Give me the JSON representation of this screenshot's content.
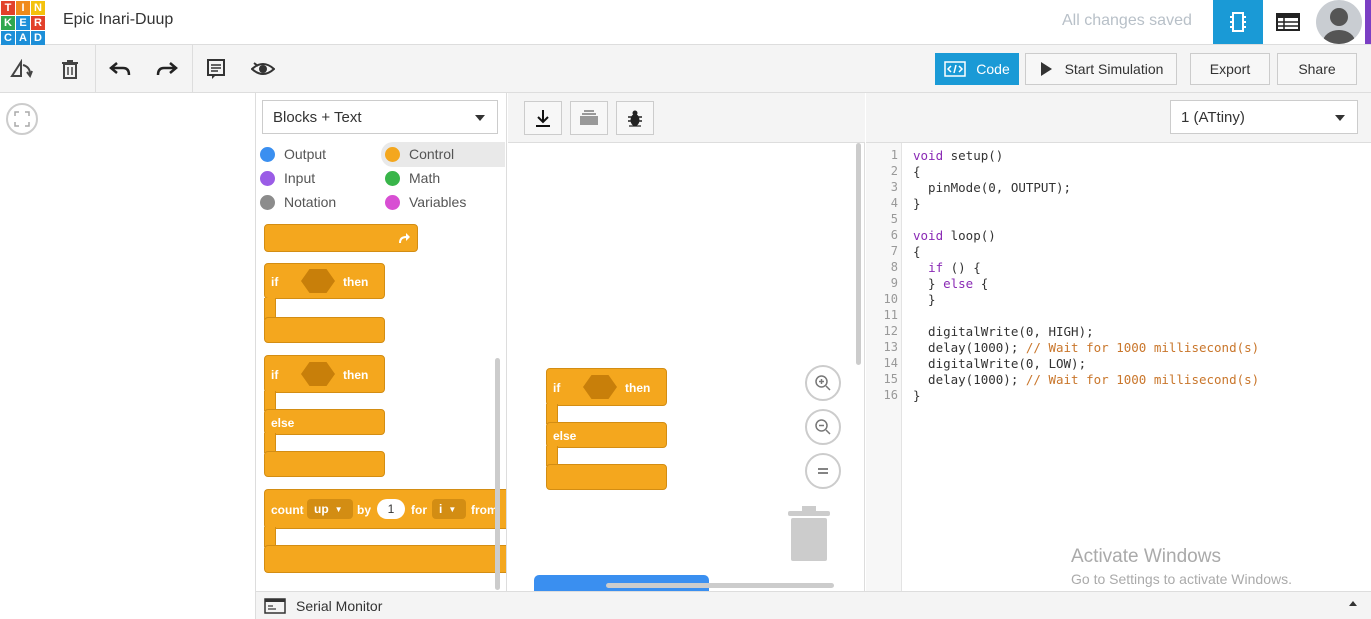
{
  "logo": {
    "letters": [
      "T",
      "I",
      "N",
      "K",
      "E",
      "R",
      "C",
      "A",
      "D"
    ],
    "colors": [
      "#e2412b",
      "#f08a1c",
      "#f4c20d",
      "#2fa84f",
      "#1d8fd8",
      "#e2412b",
      "#1d8fd8",
      "#1d8fd8",
      "#1d8fd8"
    ]
  },
  "header": {
    "project_title": "Epic Inari-Duup",
    "status": "All changes saved"
  },
  "toolbar": {
    "code_label": "Code",
    "simulation_label": "Start Simulation",
    "export_label": "Export",
    "share_label": "Share"
  },
  "blocks_panel": {
    "mode_select": "Blocks + Text",
    "categories": [
      {
        "label": "Output",
        "color": "#3a8ff0"
      },
      {
        "label": "Control",
        "color": "#f4a71e"
      },
      {
        "label": "Input",
        "color": "#9a5ce6"
      },
      {
        "label": "Math",
        "color": "#39b54a"
      },
      {
        "label": "Notation",
        "color": "#8c8c8c"
      },
      {
        "label": "Variables",
        "color": "#d84fd3"
      }
    ],
    "block_words": {
      "if": "if",
      "then": "then",
      "else": "else",
      "count": "count",
      "up": "up",
      "by": "by",
      "one": "1",
      "for": "for",
      "i": "i",
      "from": "from"
    }
  },
  "canvas_block": {
    "if": "if",
    "then": "then",
    "else": "else"
  },
  "board_select": "1 (ATtiny)",
  "code_lines": [
    {
      "n": "1",
      "html": "<span class='kw'>void</span> setup()"
    },
    {
      "n": "2",
      "html": "{"
    },
    {
      "n": "3",
      "html": "  pinMode(0, OUTPUT);"
    },
    {
      "n": "4",
      "html": "}"
    },
    {
      "n": "5",
      "html": ""
    },
    {
      "n": "6",
      "html": "<span class='kw'>void</span> loop()"
    },
    {
      "n": "7",
      "html": "{"
    },
    {
      "n": "8",
      "html": "  <span class='kw'>if</span> () {"
    },
    {
      "n": "9",
      "html": "  } <span class='kw'>else</span> {"
    },
    {
      "n": "10",
      "html": "  }"
    },
    {
      "n": "11",
      "html": ""
    },
    {
      "n": "12",
      "html": "  digitalWrite(0, HIGH);"
    },
    {
      "n": "13",
      "html": "  delay(1000); <span class='cm'>// Wait for 1000 millisecond(s)</span>"
    },
    {
      "n": "14",
      "html": "  digitalWrite(0, LOW);"
    },
    {
      "n": "15",
      "html": "  delay(1000); <span class='cm'>// Wait for 1000 millisecond(s)</span>"
    },
    {
      "n": "16",
      "html": "}"
    }
  ],
  "serial_monitor": "Serial Monitor",
  "watermark": {
    "title": "Activate Windows",
    "subtitle": "Go to Settings to activate Windows."
  }
}
